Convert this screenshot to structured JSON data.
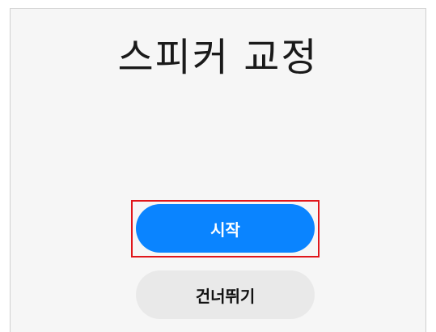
{
  "screen": {
    "title": "스피커 교정",
    "start_button_label": "시작",
    "skip_button_label": "건너뛰기"
  },
  "colors": {
    "primary": "#0a84ff",
    "secondary_bg": "#e9e9e9",
    "highlight": "#e0161b",
    "background": "#f6f6f6"
  }
}
